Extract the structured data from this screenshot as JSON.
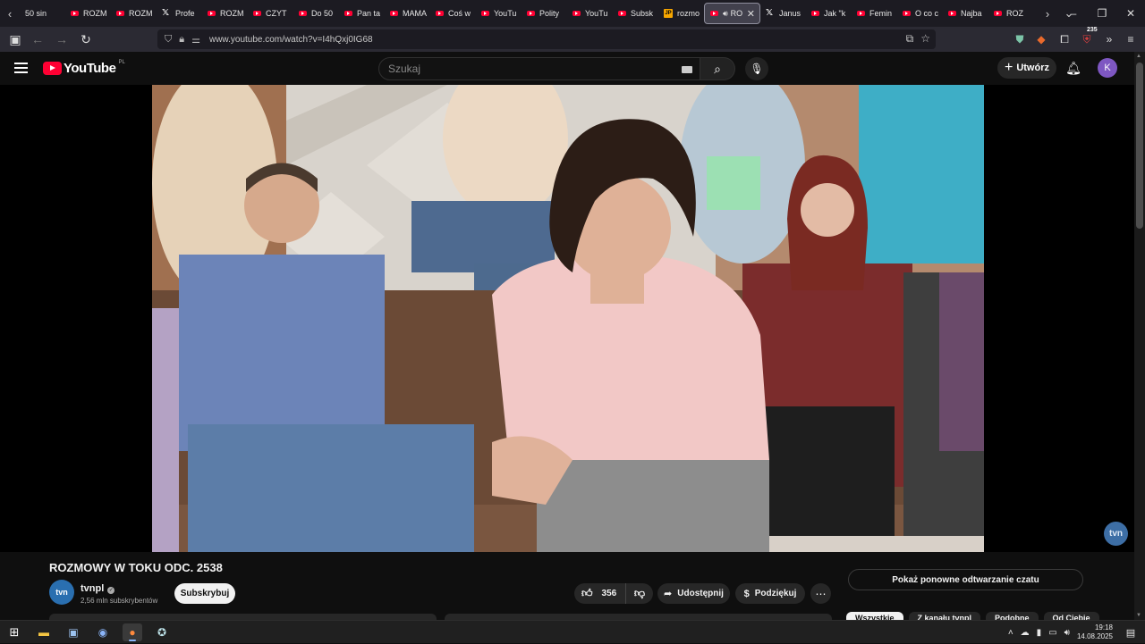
{
  "browser": {
    "tabs": [
      {
        "label": "50 sin",
        "icon": "none"
      },
      {
        "label": "ROZM",
        "icon": "youtube-icon"
      },
      {
        "label": "ROZM",
        "icon": "youtube-icon"
      },
      {
        "label": "Profe",
        "icon": "x-icon"
      },
      {
        "label": "ROZM",
        "icon": "youtube-icon"
      },
      {
        "label": "CZYT",
        "icon": "youtube-icon"
      },
      {
        "label": "Do 50",
        "icon": "youtube-icon"
      },
      {
        "label": "Pan ta",
        "icon": "youtube-icon"
      },
      {
        "label": "MAMA",
        "icon": "youtube-icon"
      },
      {
        "label": "Coś w",
        "icon": "youtube-icon"
      },
      {
        "label": "YouTu",
        "icon": "youtube-icon"
      },
      {
        "label": "Polity",
        "icon": "youtube-icon"
      },
      {
        "label": "YouTu",
        "icon": "youtube-icon"
      },
      {
        "label": "Subsk",
        "icon": "youtube-icon"
      },
      {
        "label": "rozmo",
        "icon": "jp-icon"
      },
      {
        "label": "RO",
        "icon": "youtube-icon",
        "active": true
      },
      {
        "label": "Janus",
        "icon": "x-icon"
      },
      {
        "label": "Jak \"k",
        "icon": "youtube-icon"
      },
      {
        "label": "Femin",
        "icon": "youtube-icon"
      },
      {
        "label": "O co c",
        "icon": "youtube-icon"
      },
      {
        "label": "Najba",
        "icon": "youtube-icon"
      },
      {
        "label": "ROZ",
        "icon": "youtube-icon"
      }
    ],
    "url": "www.youtube.com/watch?v=I4hQxj0IG68",
    "extension_badge": "235"
  },
  "youtube": {
    "logo_text": "YouTube",
    "country_code": "PL",
    "search_placeholder": "Szukaj",
    "create_label": "Utwórz",
    "avatar_letter": "K",
    "video": {
      "watermark": "tvn",
      "title": "ROZMOWY W TOKU ODC. 2538"
    },
    "channel": {
      "name": "tvnpl",
      "avatar_text": "tvn",
      "subscribers": "2,56 mln subskrybentów",
      "subscribe_label": "Subskrybuj"
    },
    "actions": {
      "likes": "356",
      "share_label": "Udostępnij",
      "thanks_label": "Podziękuj"
    },
    "chat_replay_label": "Pokaż ponowne odtwarzanie czatu",
    "chips": [
      "Wszystkie",
      "Z kanału tvnpl",
      "Podobne",
      "Od Ciebie"
    ]
  },
  "taskbar": {
    "time": "19:18",
    "date": "14.08.2025"
  },
  "colors": {
    "youtube_red": "#ff0033",
    "page_bg": "#0f0f0f",
    "avatar_purple": "#7e57c2"
  }
}
